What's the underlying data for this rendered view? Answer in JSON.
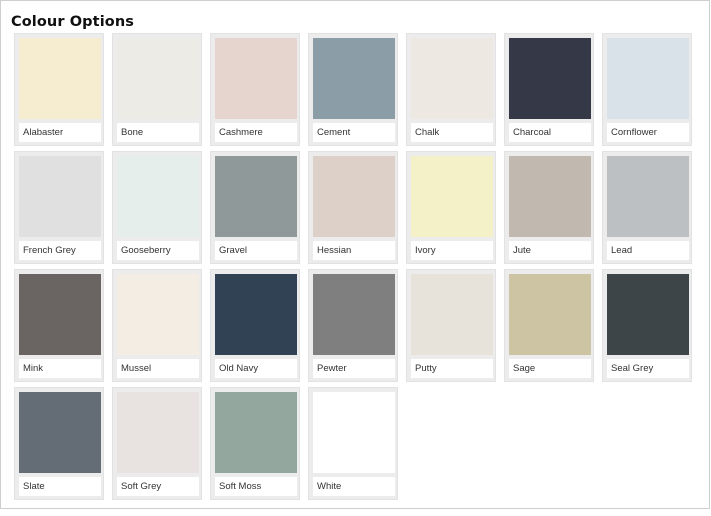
{
  "title": "Colour Options",
  "colours": [
    {
      "name": "Alabaster",
      "hex": "#f6ecd0"
    },
    {
      "name": "Bone",
      "hex": "#ecebe6"
    },
    {
      "name": "Cashmere",
      "hex": "#e6d5cf"
    },
    {
      "name": "Cement",
      "hex": "#8b9ea8"
    },
    {
      "name": "Chalk",
      "hex": "#ede8e1"
    },
    {
      "name": "Charcoal",
      "hex": "#353947"
    },
    {
      "name": "Cornflower",
      "hex": "#d8e2e8"
    },
    {
      "name": "French Grey",
      "hex": "#e0e0e0"
    },
    {
      "name": "Gooseberry",
      "hex": "#e5eeea"
    },
    {
      "name": "Gravel",
      "hex": "#8f9999"
    },
    {
      "name": "Hessian",
      "hex": "#dcd0c8"
    },
    {
      "name": "Ivory",
      "hex": "#f4f0c8"
    },
    {
      "name": "Jute",
      "hex": "#c1b8b0"
    },
    {
      "name": "Lead",
      "hex": "#bcc0c2"
    },
    {
      "name": "Mink",
      "hex": "#6a6462"
    },
    {
      "name": "Mussel",
      "hex": "#f3ede4"
    },
    {
      "name": "Old Navy",
      "hex": "#314254"
    },
    {
      "name": "Pewter",
      "hex": "#7f7f80"
    },
    {
      "name": "Putty",
      "hex": "#e7e3da"
    },
    {
      "name": "Sage",
      "hex": "#cdc4a4"
    },
    {
      "name": "Seal Grey",
      "hex": "#3e4548"
    },
    {
      "name": "Slate",
      "hex": "#646d76"
    },
    {
      "name": "Soft Grey",
      "hex": "#e8e3e0"
    },
    {
      "name": "Soft Moss",
      "hex": "#94a79f"
    },
    {
      "name": "White",
      "hex": "#ffffff"
    }
  ]
}
